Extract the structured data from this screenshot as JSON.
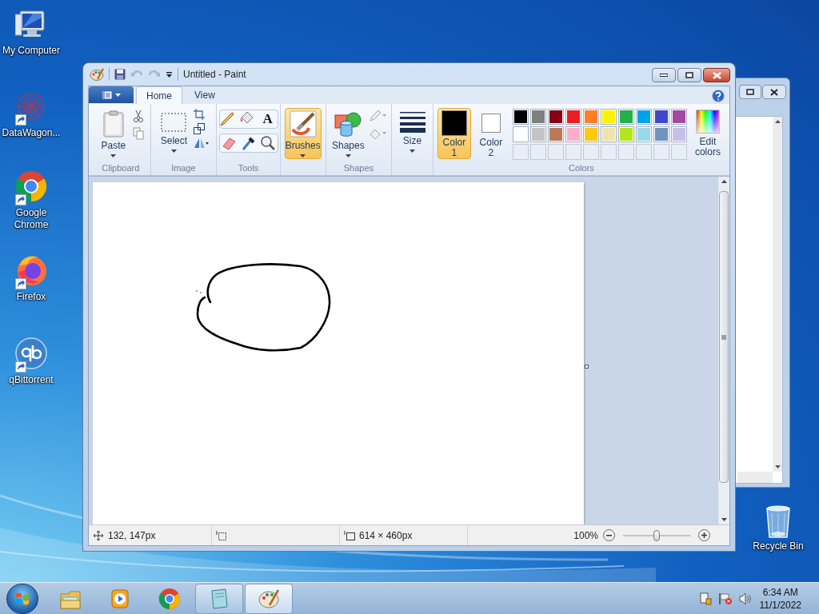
{
  "desktop_icons": [
    {
      "label": "My Computer",
      "shortcut": false
    },
    {
      "label": "DataWagon...",
      "shortcut": true
    },
    {
      "label": "Google Chrome",
      "shortcut": true
    },
    {
      "label": "Firefox",
      "shortcut": true
    },
    {
      "label": "qBittorrent",
      "shortcut": true
    },
    {
      "label": "Recycle Bin",
      "shortcut": false
    }
  ],
  "paint_window": {
    "title": "Untitled - Paint",
    "tabs": [
      {
        "label": "Home",
        "selected": true
      },
      {
        "label": "View",
        "selected": false
      }
    ],
    "ribbon": {
      "clipboard": {
        "label": "Clipboard",
        "paste": "Paste"
      },
      "image": {
        "label": "Image",
        "select": "Select"
      },
      "tools": {
        "label": "Tools",
        "text_tool": "A"
      },
      "brushes": {
        "label": "Brushes",
        "selected": true
      },
      "shapes": {
        "label": "Shapes",
        "button": "Shapes",
        "selected": false
      },
      "size": {
        "label": "Size"
      },
      "colors": {
        "label": "Colors",
        "slots": [
          {
            "label": "Color 1",
            "color": "#000000",
            "selected": true
          },
          {
            "label": "Color 2",
            "color": "#ffffff",
            "selected": false
          }
        ],
        "palette": [
          {
            "color": "#000000"
          },
          {
            "color": "#7f7f7f"
          },
          {
            "color": "#880015"
          },
          {
            "color": "#ed1c24"
          },
          {
            "color": "#ff7f27"
          },
          {
            "color": "#fff200"
          },
          {
            "color": "#22b14c"
          },
          {
            "color": "#00a2e8"
          },
          {
            "color": "#3f48cc"
          },
          {
            "color": "#a349a4"
          },
          {
            "color": "#ffffff"
          },
          {
            "color": "#c3c3c3"
          },
          {
            "color": "#b97a57"
          },
          {
            "color": "#ffaec9"
          },
          {
            "color": "#ffc90e"
          },
          {
            "color": "#efe4b0"
          },
          {
            "color": "#b5e61d"
          },
          {
            "color": "#99d9ea"
          },
          {
            "color": "#7092be"
          },
          {
            "color": "#c8bfe7"
          }
        ],
        "edit_colors": "Edit colors"
      }
    },
    "status_bar": {
      "position": "132, 147px",
      "canvas_size": "614 × 460px",
      "zoom": "100%",
      "zoom_slider": {
        "level": 0.5
      }
    }
  },
  "taskbar": {
    "apps": [
      {
        "open": false,
        "selected": false
      },
      {
        "open": false,
        "selected": false
      },
      {
        "open": false,
        "selected": false
      },
      {
        "open": true,
        "selected": false
      },
      {
        "open": true,
        "selected": true
      }
    ],
    "clock": {
      "time": "6:34 AM",
      "date": "11/1/2022"
    }
  }
}
